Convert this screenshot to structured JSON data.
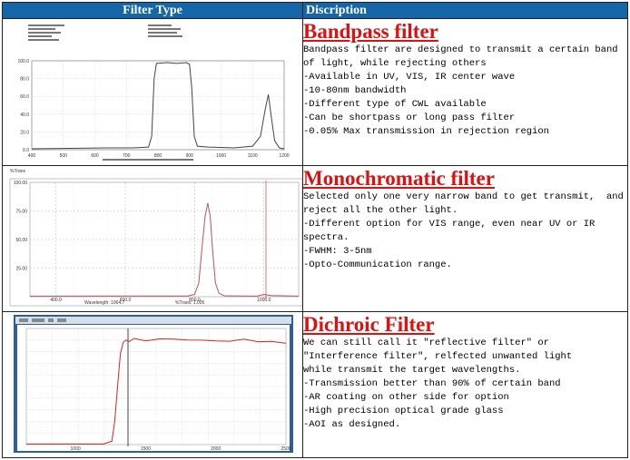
{
  "header": {
    "col1": "Filter Type",
    "col2": "Discription"
  },
  "rows": [
    {
      "title": "Bandpass filter",
      "lines": [
        "Bandpass filter are designed to transmit a certain band of light, while rejecting others",
        "-Available in UV, VIS, IR center wave",
        "-10-80nm bandwidth",
        "-Different type of CWL available",
        "-Can be shortpass or long pass filter",
        "-0.05% Max transmission in rejection region"
      ],
      "chart": {
        "yticks": [
          "0.0",
          "20.0",
          "40.0",
          "60.0",
          "80.0",
          "100.0"
        ],
        "xticks": [
          "400",
          "500",
          "600",
          "700",
          "800",
          "900",
          "1000",
          "1100",
          "1200"
        ],
        "color": "#444444"
      }
    },
    {
      "title": "Monochromatic filter",
      "lines": [
        "Selected only one very narrow band to get transmit,  and reject all the other light.",
        "-Different option for VIS range, even near UV or IR spectra.",
        "-FWHM: 3-5nm",
        "-Opto-Communication range."
      ],
      "chart": {
        "ylabel": "%Trans",
        "yticks": [
          "25.00",
          "50.00",
          "75.00",
          "100.00"
        ],
        "xticks": [
          "400.0",
          "600.0",
          "800.0",
          "1000.0"
        ],
        "xlabel": "Wavelength: 1064.7",
        "status": "%Trans: 1.005",
        "color": "#c0505a"
      }
    },
    {
      "title": "Dichroic Filter",
      "lines": [
        "We can still call it \"reflective filter\" or \"Interference filter\", relfected unwanted light",
        "while transmit the target wavelengths.",
        "-Transmission better than 90% of certain band",
        "-AR coating on other side for option",
        "-High precision optical grade glass",
        "-AOI as designed."
      ],
      "chart": {
        "xticks": [
          "1000",
          "1500",
          "2000",
          "2500"
        ],
        "color": "#e02020"
      }
    }
  ]
}
